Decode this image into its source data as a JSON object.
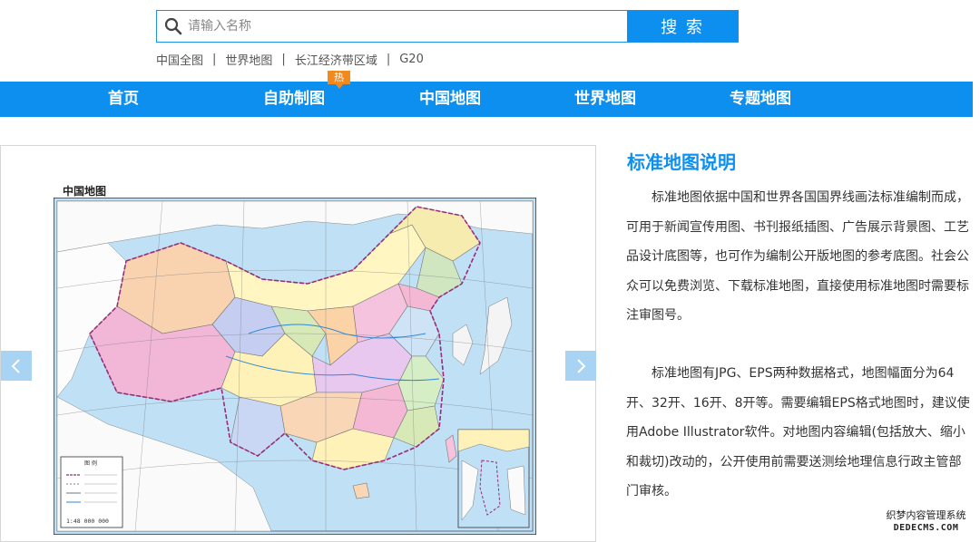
{
  "search": {
    "placeholder": "请输入名称",
    "button_label": "搜 索"
  },
  "quick_links": [
    "中国全图",
    "世界地图",
    "长江经济带区域",
    "G20"
  ],
  "quick_link_separator": "|",
  "nav": {
    "items": [
      "首页",
      "自助制图",
      "中国地图",
      "世界地图",
      "专题地图"
    ],
    "hot_badge": "热"
  },
  "map": {
    "title": "中国地图",
    "scale_text": "1:48 000 000",
    "legend_title": "图 例"
  },
  "side": {
    "title": "标准地图说明",
    "paragraphs": [
      "标准地图依据中国和世界各国国界线画法标准编制而成，可用于新闻宣传用图、书刊报纸插图、广告展示背景图、工艺品设计底图等，也可作为编制公开版地图的参考底图。社会公众可以免费浏览、下载标准地图，直接使用标准地图时需要标注审图号。",
      "标准地图有JPG、EPS两种数据格式，地图幅面分为64开、32开、16开、8开等。需要编辑EPS格式地图时，建议使用Adobe Illustrator软件。对地图内容编辑(包括放大、缩小和裁切)改动的，公开使用前需要送测绘地理信息行政主管部门审核。"
    ]
  },
  "watermark": {
    "line1": "织梦内容管理系统",
    "line2": "DEDECMS.COM"
  },
  "colors": {
    "brand_blue": "#0d8fef",
    "hot_orange": "#f08a1c",
    "arrow_bg": "#a8d3f3",
    "sea": "#bfe0f5"
  }
}
